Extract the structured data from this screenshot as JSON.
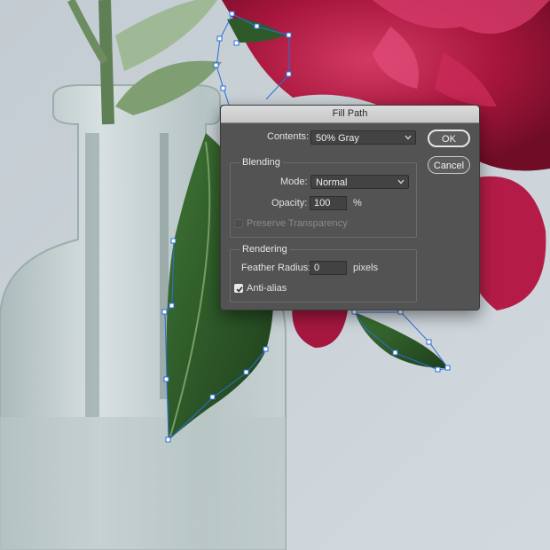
{
  "dialog": {
    "title": "Fill Path",
    "contents_label": "Contents:",
    "contents_value": "50% Gray",
    "ok_label": "OK",
    "cancel_label": "Cancel",
    "blending": {
      "group_label": "Blending",
      "mode_label": "Mode:",
      "mode_value": "Normal",
      "opacity_label": "Opacity:",
      "opacity_value": "100",
      "opacity_unit": "%",
      "preserve_label": "Preserve Transparency",
      "preserve_checked": false,
      "preserve_enabled": false
    },
    "rendering": {
      "group_label": "Rendering",
      "feather_label": "Feather Radius:",
      "feather_value": "0",
      "feather_unit": "pixels",
      "antialias_label": "Anti-alias",
      "antialias_checked": true
    }
  },
  "colors": {
    "dialog_bg": "#535353",
    "path_stroke": "#2b6fd6",
    "peony": "#b21a44",
    "leaf": "#2e5a2a",
    "backdrop": "#c9d2d8"
  },
  "icons": {
    "chevron": "chevron-down-icon",
    "check": "checkmark-icon"
  }
}
